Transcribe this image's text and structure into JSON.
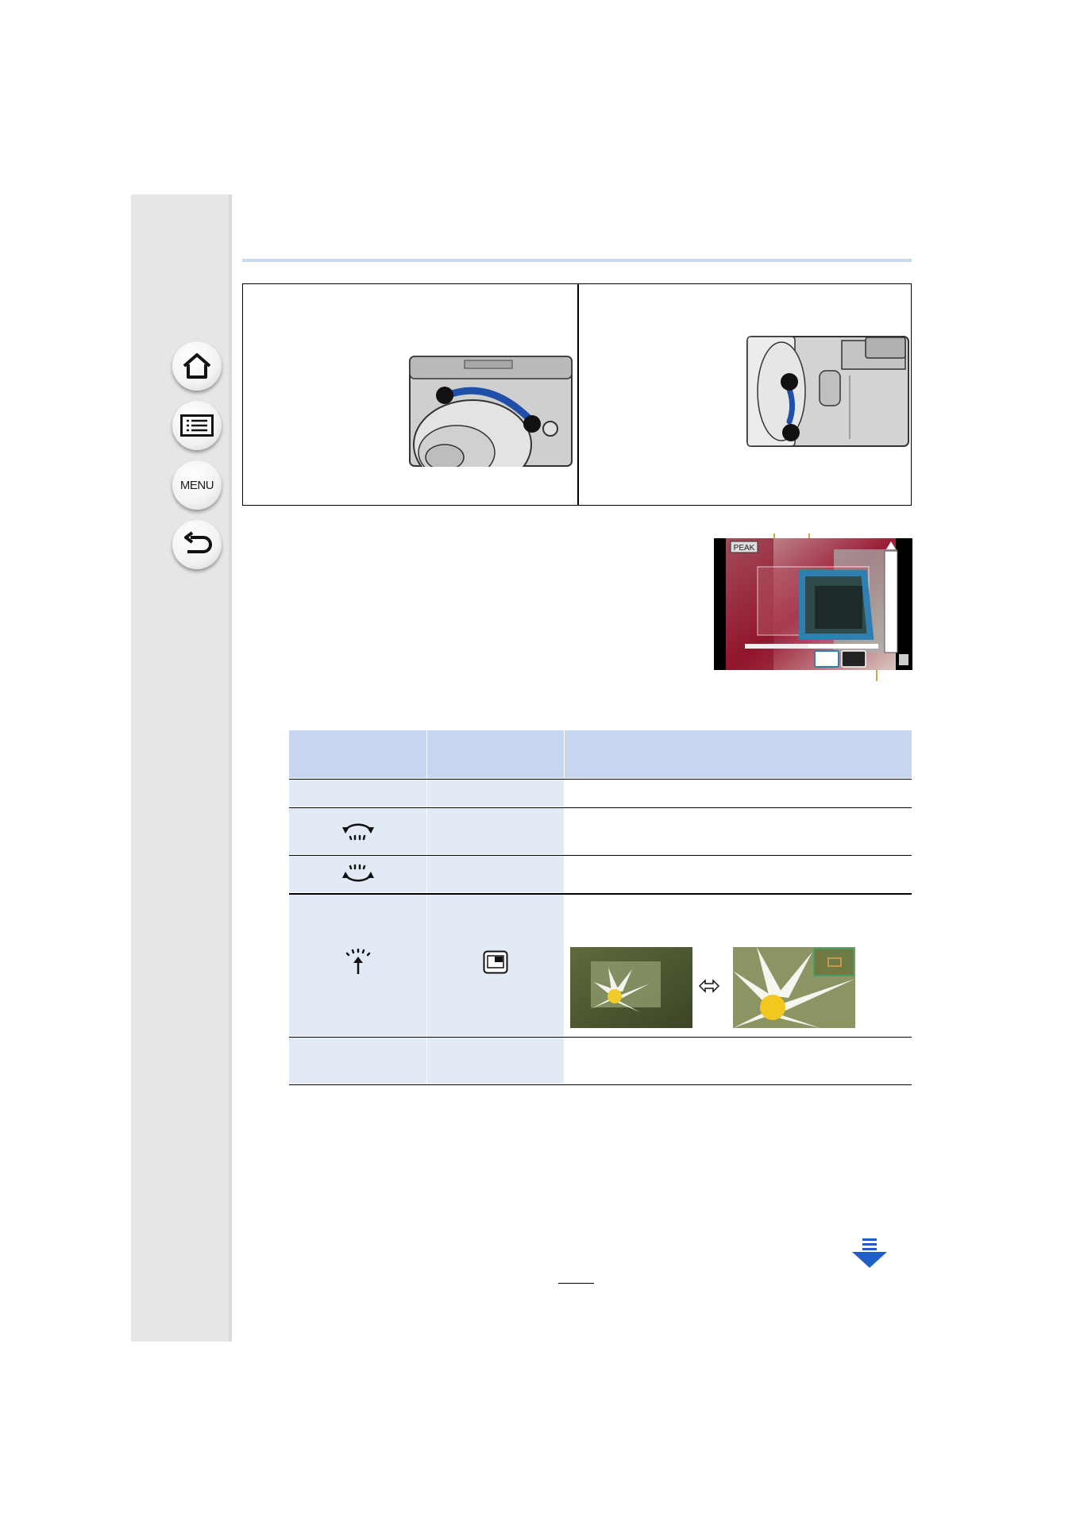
{
  "nav": {
    "home_label": "",
    "contents_label": "",
    "menu_label": "MENU",
    "back_label": ""
  },
  "illustrations": {
    "left_callouts": [
      "",
      ""
    ],
    "right_callouts": [
      "",
      ""
    ],
    "screen_peak_label": "PEAK",
    "screen_callouts": [
      "",
      "",
      ""
    ]
  },
  "table": {
    "headers": [
      "",
      "",
      ""
    ],
    "rows": [
      {
        "col1": "",
        "col2": "",
        "col3": ""
      },
      {
        "col1_icon": "dial-rotate-ccw-icon",
        "col2": "",
        "col3": ""
      },
      {
        "col1_icon": "dial-rotate-cw-icon",
        "col2": "",
        "col3": ""
      },
      {
        "col1_icon": "dial-press-icon",
        "col2_icon": "pip-display-icon",
        "col3": ""
      },
      {
        "col1": "",
        "col2": "",
        "col3": ""
      }
    ]
  },
  "colors": {
    "header_rule": "#c7d9ef",
    "table_header": "#c6d6ee",
    "table_cell": "#e2eaf6",
    "accent_blue": "#1f4fa8",
    "sidebar": "#e6e6e6"
  },
  "page": {
    "number": ""
  }
}
